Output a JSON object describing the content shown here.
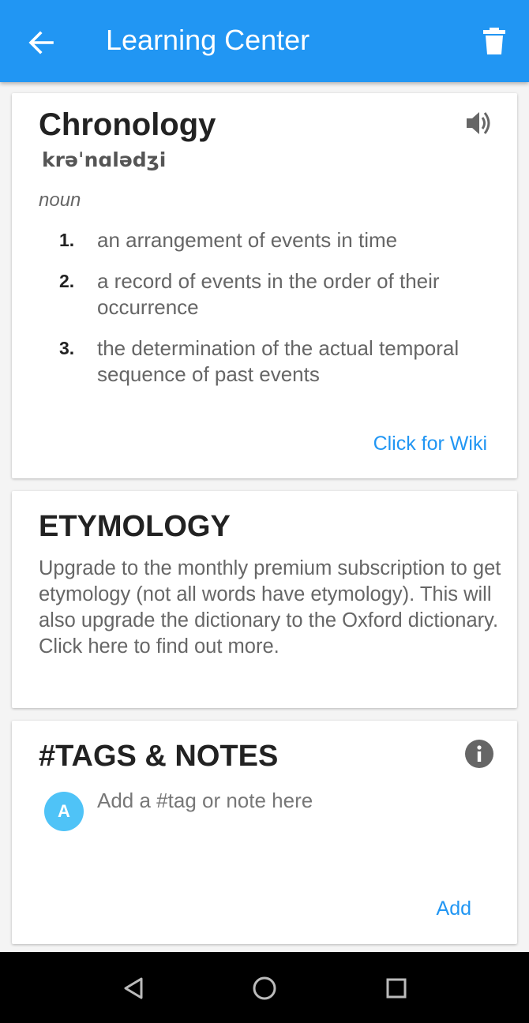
{
  "colors": {
    "primary": "#2196f3",
    "avatar": "#4fc3f7"
  },
  "appbar": {
    "title": "Learning Center",
    "back_icon": "arrow-left-icon",
    "delete_icon": "trash-icon"
  },
  "word_card": {
    "word": "Chronology",
    "phonetic": "krəˈnɑlədʒi",
    "part_of_speech": "noun",
    "definitions": [
      {
        "num": "1.",
        "text": "an arrangement of events in time"
      },
      {
        "num": "2.",
        "text": "a record of events in the order of their occurrence"
      },
      {
        "num": "3.",
        "text": "the determination of the actual temporal sequence of past events"
      }
    ],
    "wiki_link": "Click for Wiki",
    "speaker_icon": "speaker-icon"
  },
  "etymology": {
    "title": "ETYMOLOGY",
    "text": "Upgrade to the monthly premium subscription to get etymology (not all words have etymology). This will also upgrade the dictionary to the Oxford dictionary. Click here to find out more."
  },
  "tags": {
    "title": "#TAGS & NOTES",
    "avatar_letter": "A",
    "placeholder": "Add a #tag or note here",
    "add_label": "Add",
    "info_icon": "info-icon"
  },
  "navbar": {
    "icons": [
      "back-triangle-icon",
      "home-circle-icon",
      "recents-square-icon"
    ]
  }
}
